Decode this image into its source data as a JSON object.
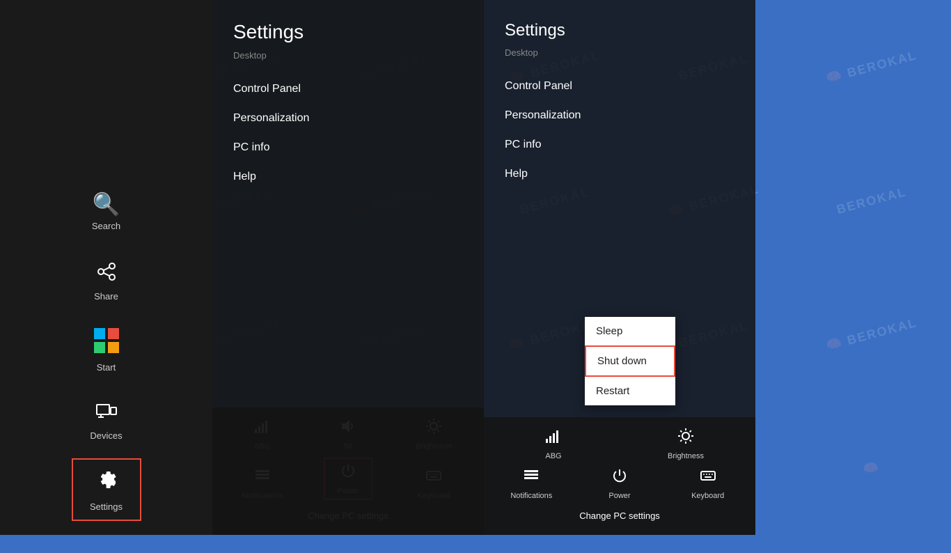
{
  "sidebar": {
    "items": [
      {
        "id": "search",
        "label": "Search",
        "icon": "🔍"
      },
      {
        "id": "share",
        "label": "Share",
        "icon": "↗"
      },
      {
        "id": "start",
        "label": "Start",
        "icon": "⊞"
      },
      {
        "id": "devices",
        "label": "Devices",
        "icon": "⊡"
      },
      {
        "id": "settings",
        "label": "Settings",
        "icon": "⚙"
      }
    ]
  },
  "leftPanel": {
    "title": "Settings",
    "subtitle": "Desktop",
    "menuItems": [
      "Control Panel",
      "Personalization",
      "PC info",
      "Help"
    ]
  },
  "leftBottomIcons": [
    {
      "id": "network",
      "icon": "📶",
      "label": "ABG"
    },
    {
      "id": "volume",
      "icon": "🔊",
      "label": "56"
    },
    {
      "id": "brightness",
      "icon": "☀",
      "label": "Brightness"
    }
  ],
  "leftBottomIcons2": [
    {
      "id": "notifications-left",
      "icon": "☰",
      "label": "Notifications"
    },
    {
      "id": "power-left",
      "icon": "⏻",
      "label": "Power",
      "highlight": true
    },
    {
      "id": "keyboard-left",
      "icon": "⌨",
      "label": "Keyboard"
    }
  ],
  "changePcSettings": "Change PC settings",
  "rightPanel": {
    "title": "Settings",
    "subtitle": "Desktop",
    "menuItems": [
      "Control Panel",
      "Personalization",
      "PC info",
      "Help"
    ]
  },
  "rightBottomIcons": [
    {
      "id": "network-right",
      "icon": "📶",
      "label": "ABG"
    },
    {
      "id": "brightness-right",
      "icon": "☀",
      "label": "Brightness"
    }
  ],
  "rightBottomIcons2": [
    {
      "id": "notifications-right",
      "icon": "☰",
      "label": "Notifications"
    },
    {
      "id": "power-right",
      "icon": "⏻",
      "label": "Power"
    },
    {
      "id": "keyboard-right",
      "icon": "⌨",
      "label": "Keyboard"
    }
  ],
  "powerMenu": {
    "items": [
      {
        "id": "sleep",
        "label": "Sleep",
        "highlight": false
      },
      {
        "id": "shutdown",
        "label": "Shut down",
        "highlight": true
      },
      {
        "id": "restart",
        "label": "Restart",
        "highlight": false
      }
    ]
  },
  "watermark": {
    "text": "BEROKAL"
  }
}
